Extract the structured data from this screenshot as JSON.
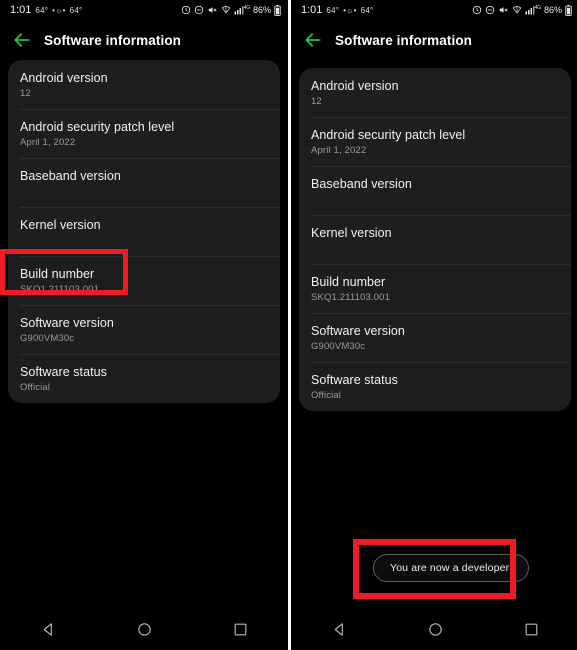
{
  "status_bar": {
    "clock": "1:01",
    "temp_primary": "64°",
    "temp_secondary": "64°",
    "network_label": "4G",
    "battery_percent": "86%",
    "icons": [
      "alarm-icon",
      "do-not-disturb-icon",
      "volume-muted-icon",
      "wifi-icon",
      "cellular-signal-icon",
      "battery-icon"
    ]
  },
  "app_bar": {
    "title": "Software information",
    "back_icon": "back-arrow-icon",
    "accent_color": "#1fc14c"
  },
  "info_list": [
    {
      "title": "Android version",
      "value": "12"
    },
    {
      "title": "Android security patch level",
      "value": "April 1, 2022"
    },
    {
      "title": "Baseband version",
      "value": ""
    },
    {
      "title": "Kernel version",
      "value": ""
    },
    {
      "title": "Build number",
      "value": "SKQ1.211103.001"
    },
    {
      "title": "Software version",
      "value": "G900VM30c"
    },
    {
      "title": "Software status",
      "value": "Official"
    }
  ],
  "toast": {
    "message": "You are now a developer!"
  },
  "highlight": {
    "color": "#ee1c25"
  },
  "nav_bar": {
    "back_label": "back-triangle-icon",
    "home_label": "home-circle-icon",
    "recents_label": "recents-square-icon"
  }
}
